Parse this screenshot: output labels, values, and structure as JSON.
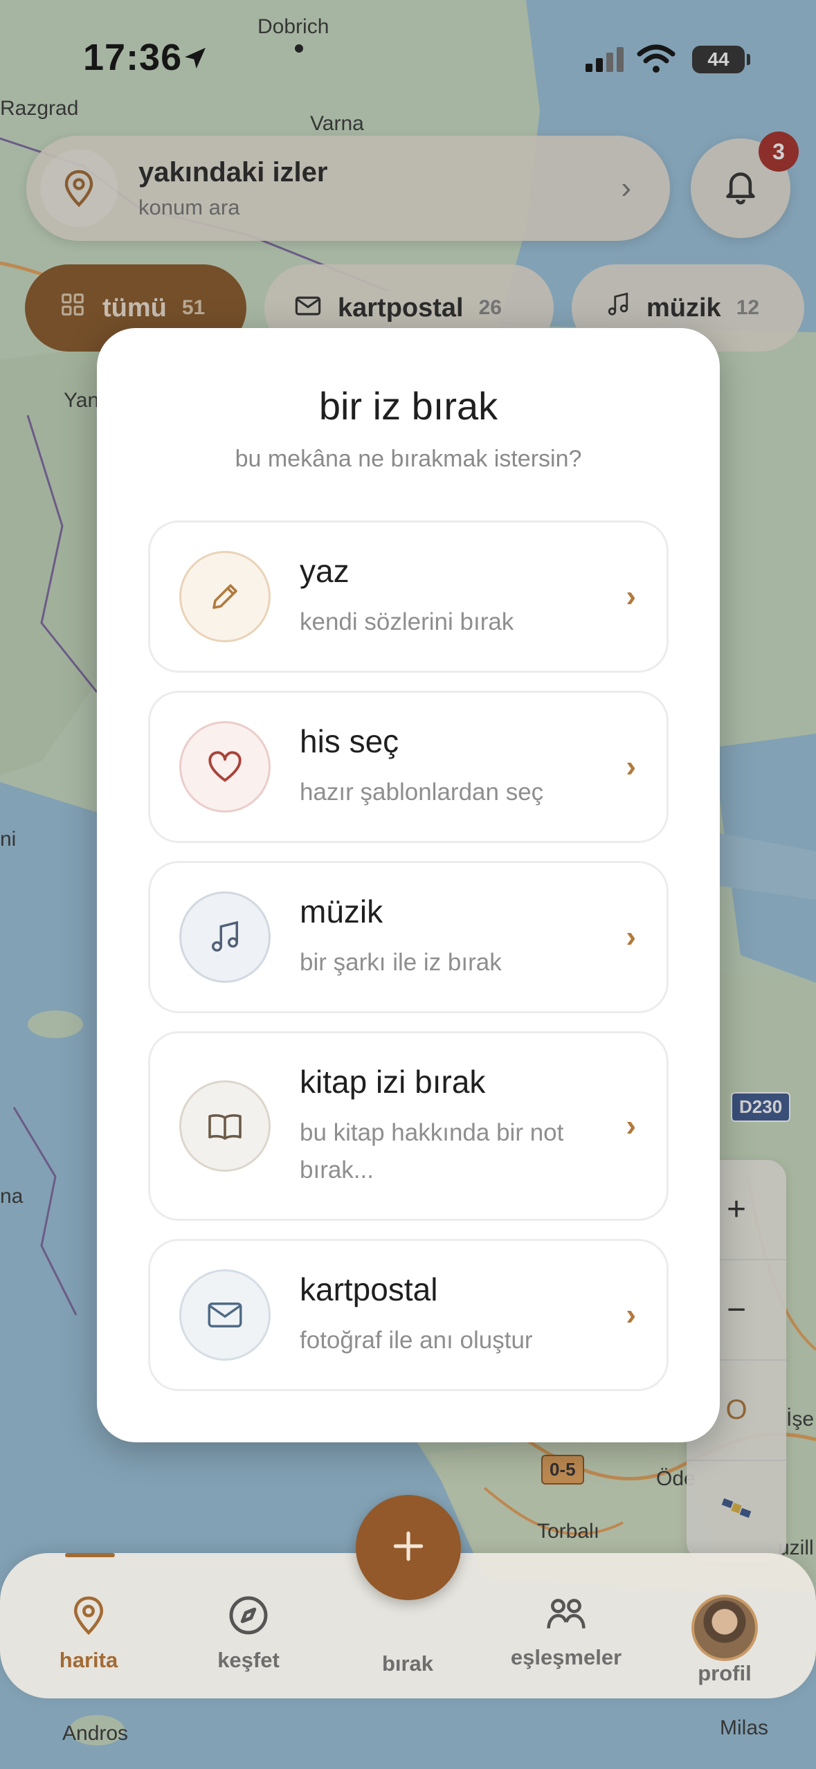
{
  "status_bar": {
    "time": "17:36",
    "battery": "44"
  },
  "map": {
    "labels": [
      "Dobrich",
      "Razgrad",
      "Varna",
      "Yan",
      "ni",
      "na",
      "Torbalı",
      "Öde",
      "İşe",
      "uzill",
      "Andros",
      "Milas"
    ],
    "road_shields": [
      "D230",
      "0-5"
    ]
  },
  "header": {
    "title": "yakındaki izler",
    "subtitle": "konum ara",
    "notification_count": "3"
  },
  "filters": [
    {
      "label": "tümü",
      "count": "51"
    },
    {
      "label": "kartpostal",
      "count": "26"
    },
    {
      "label": "müzik",
      "count": "12"
    }
  ],
  "map_controls": {
    "zoom_in": "+",
    "zoom_out": "−",
    "orient": "O"
  },
  "modal": {
    "title": "bir iz bırak",
    "subtitle": "bu mekâna ne bırakmak istersin?",
    "options": [
      {
        "title": "yaz",
        "desc": "kendi sözlerini bırak",
        "icon": "pencil-icon"
      },
      {
        "title": "his seç",
        "desc": "hazır şablonlardan seç",
        "icon": "heart-icon"
      },
      {
        "title": "müzik",
        "desc": "bir şarkı ile iz bırak",
        "icon": "music-note-icon"
      },
      {
        "title": "kitap izi bırak",
        "desc": "bu kitap hakkında bir not bırak...",
        "icon": "book-icon"
      },
      {
        "title": "kartpostal",
        "desc": "fotoğraf ile anı oluştur",
        "icon": "envelope-icon"
      }
    ]
  },
  "nav": {
    "items": [
      {
        "label": "harita"
      },
      {
        "label": "keşfet"
      },
      {
        "label": "bırak"
      },
      {
        "label": "eşleşmeler"
      },
      {
        "label": "profil"
      }
    ]
  },
  "colors": {
    "accent": "#93592a",
    "accent_text": "#a26b34",
    "badge": "#a8312b"
  }
}
